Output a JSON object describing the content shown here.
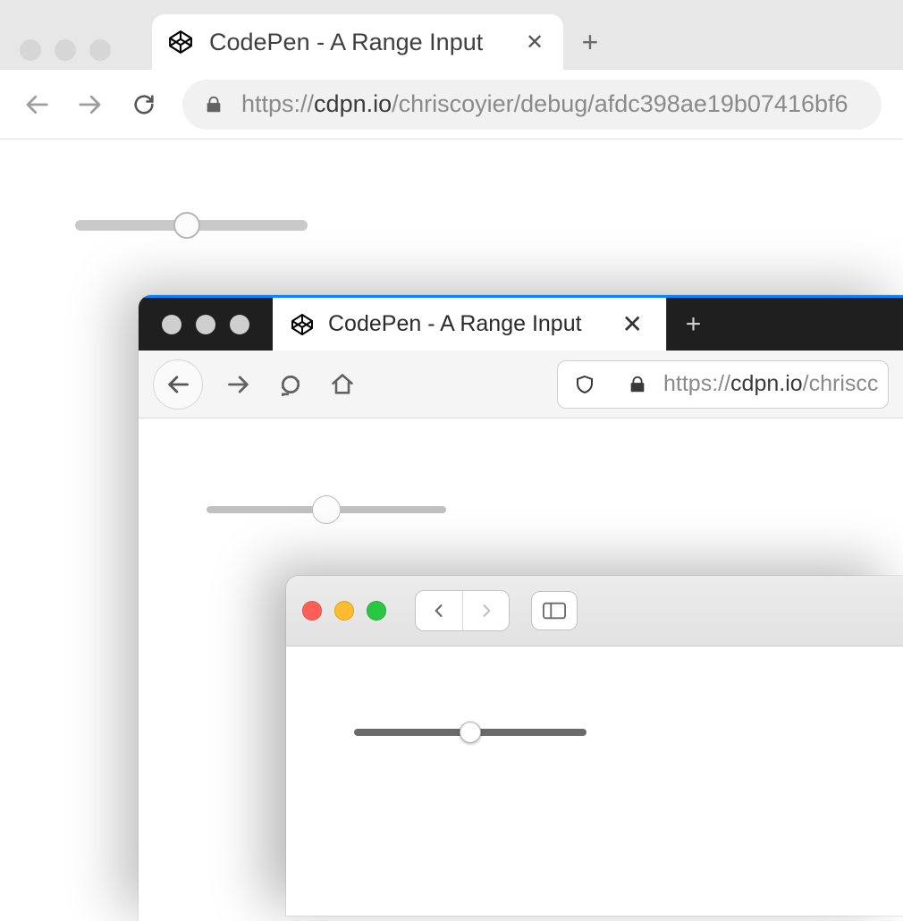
{
  "browser1": {
    "tab_title": "CodePen - A Range Input",
    "url_scheme": "https://",
    "url_host": "cdpn.io",
    "url_path": "/chriscoyier/debug/afdc398ae19b07416bf6",
    "slider": {
      "value_percent": 48
    }
  },
  "browser2": {
    "tab_title": "CodePen - A Range Input",
    "url_scheme": "https://",
    "url_host": "cdpn.io",
    "url_path": "/chriscc",
    "slider": {
      "value_percent": 50
    }
  },
  "browser3": {
    "slider": {
      "value_percent": 50
    }
  }
}
